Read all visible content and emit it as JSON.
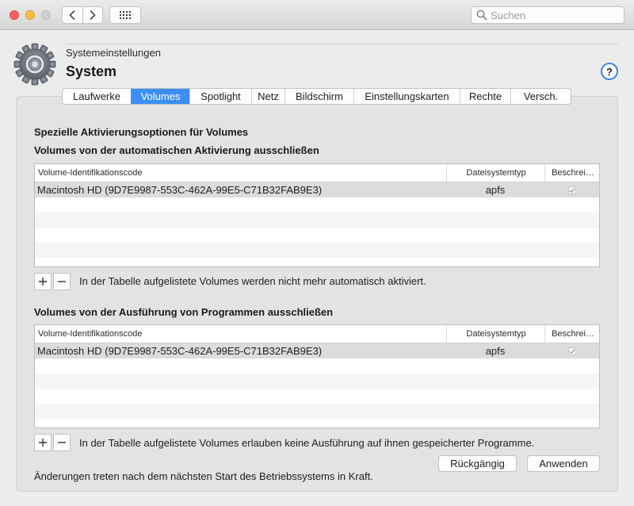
{
  "toolbar": {
    "search_placeholder": "Suchen",
    "back_icon": "chevron-left-icon",
    "forward_icon": "chevron-right-icon",
    "grid_icon": "grid-icon"
  },
  "header": {
    "breadcrumb": "Systemeinstellungen",
    "title": "System",
    "help_label": "?",
    "icon": "gear-icon"
  },
  "tabs": [
    {
      "label": "Laufwerke"
    },
    {
      "label": "Volumes"
    },
    {
      "label": "Spotlight"
    },
    {
      "label": "Netz"
    },
    {
      "label": "Bildschirm"
    },
    {
      "label": "Einstellungskarten"
    },
    {
      "label": "Rechte"
    },
    {
      "label": "Versch."
    }
  ],
  "active_tab": "Volumes",
  "main": {
    "section_title": "Spezielle Aktivierungsoptionen für Volumes",
    "mount_section": {
      "heading": "Volumes von der automatischen Aktivierung ausschließen",
      "columns": [
        "Volume-Identifikationscode",
        "Dateisystemtyp",
        "Beschrei…"
      ],
      "rows": [
        {
          "id": "Macintosh HD (9D7E9987-553C-462A-99E5-C71B32FAB9E3)",
          "fs": "apfs",
          "checked": true
        }
      ],
      "note": "In der Tabelle aufgelistete Volumes werden nicht mehr automatisch aktiviert."
    },
    "exec_section": {
      "heading": "Volumes von der Ausführung von Programmen ausschließen",
      "columns": [
        "Volume-Identifikationscode",
        "Dateisystemtyp",
        "Beschrei…"
      ],
      "rows": [
        {
          "id": "Macintosh HD (9D7E9987-553C-462A-99E5-C71B32FAB9E3)",
          "fs": "apfs",
          "checked": true
        }
      ],
      "note": "In der Tabelle aufgelistete Volumes erlauben keine Ausführung auf ihnen gespeicherter Programme."
    },
    "footer_note": "Änderungen treten nach dem nächsten Start des Betriebssystems in Kraft.",
    "revert_label": "Rückgängig",
    "apply_label": "Anwenden"
  },
  "colors": {
    "accent": "#3b8ef5",
    "help_ring": "#3d82e3",
    "close": "#fc605c",
    "minimize": "#fdbc40"
  }
}
